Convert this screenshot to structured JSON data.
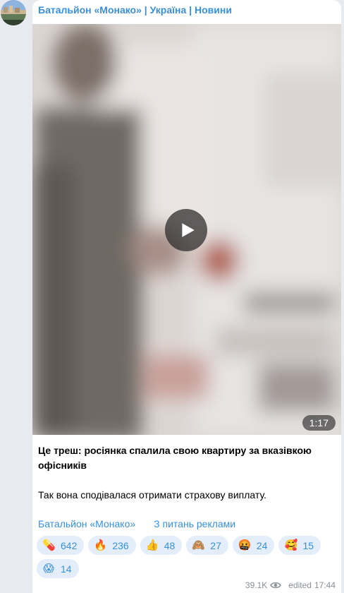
{
  "channel": {
    "name": "Батальйон «Монако» | Україна | Новини"
  },
  "post": {
    "video_duration": "1:17",
    "headline": "Це треш: росіянка спалила свою квартиру за вказівкою офісників",
    "body": "Так вона сподівалася отримати страхову виплату.",
    "links": [
      {
        "label": "Батальйон «Монако»"
      },
      {
        "label": "З питань реклами"
      }
    ],
    "reactions": [
      {
        "emoji": "💊",
        "icon": "pill-icon",
        "count": "642"
      },
      {
        "emoji": "🔥",
        "icon": "fire-icon",
        "count": "236"
      },
      {
        "emoji": "👍",
        "icon": "thumbs-up-icon",
        "count": "48"
      },
      {
        "emoji": "🙈",
        "icon": "see-no-evil-monkey-icon",
        "count": "27"
      },
      {
        "emoji": "🤬",
        "icon": "angry-face-icon",
        "count": "24"
      },
      {
        "emoji": "🥰",
        "icon": "smiling-hearts-face-icon",
        "count": "15"
      },
      {
        "emoji": "😱",
        "icon": "screaming-face-icon",
        "count": "14"
      }
    ],
    "views": "39.1K",
    "edited_label": "edited",
    "time": "17:44"
  },
  "colors": {
    "accent": "#3a8fd9",
    "bubble": "#ffffff",
    "background": "#e7ebf0",
    "reaction_bg": "#e3eefa"
  }
}
